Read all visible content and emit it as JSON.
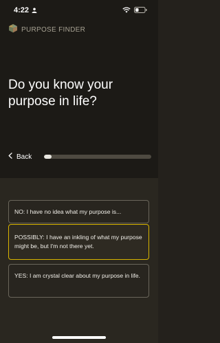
{
  "status_bar": {
    "time": "4:22"
  },
  "brand": {
    "name": "PURPOSE FINDER"
  },
  "question": {
    "text": "Do you know your purpose in life?"
  },
  "navigation": {
    "back_label": "Back",
    "progress_fraction": 0.04
  },
  "options": [
    {
      "text": "NO: I have no idea what my purpose is...",
      "selected": false
    },
    {
      "text": "POSSIBLY: I have an inkling of what my purpose might be, but I'm not there yet.",
      "selected": true
    },
    {
      "text": "YES: I am crystal clear about my purpose in life.",
      "selected": false
    }
  ],
  "colors": {
    "accent": "#d9b500",
    "background_top": "#1c1a16",
    "background_bottom": "#2a2720"
  }
}
